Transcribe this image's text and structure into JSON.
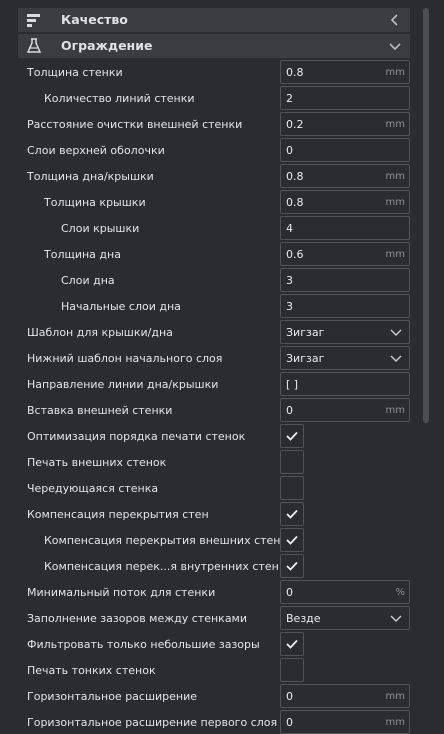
{
  "categories": [
    {
      "label": "Качество",
      "icon": "quality-icon",
      "chevron": "chevron-left-icon"
    },
    {
      "label": "Ограждение",
      "icon": "shell-icon",
      "chevron": "chevron-down-icon"
    }
  ],
  "settings": [
    {
      "label": "Толщина стенки",
      "value": "0.8",
      "unit": "mm"
    },
    {
      "label": "Количество линий стенки",
      "value": "2",
      "unit": ""
    },
    {
      "label": "Расстояние очистки внешней стенки",
      "value": "0.2",
      "unit": "mm"
    },
    {
      "label": "Слои верхней оболочки",
      "value": "0",
      "unit": ""
    },
    {
      "label": "Толщина дна/крышки",
      "value": "0.8",
      "unit": "mm"
    },
    {
      "label": "Толщина крышки",
      "value": "0.8",
      "unit": "mm"
    },
    {
      "label": "Слои крышки",
      "value": "4",
      "unit": ""
    },
    {
      "label": "Толщина дна",
      "value": "0.6",
      "unit": "mm"
    },
    {
      "label": "Слои дна",
      "value": "3",
      "unit": ""
    },
    {
      "label": "Начальные слои дна",
      "value": "3",
      "unit": ""
    },
    {
      "label": "Шаблон для крышки/дна",
      "value": "Зигзаг",
      "unit": ""
    },
    {
      "label": "Нижний шаблон начального слоя",
      "value": "Зигзаг",
      "unit": ""
    },
    {
      "label": "Направление линии дна/крышки",
      "value": "[ ]",
      "unit": ""
    },
    {
      "label": "Вставка внешней стенки",
      "value": "0",
      "unit": "mm"
    },
    {
      "label": "Оптимизация порядка печати стенок",
      "checked": true
    },
    {
      "label": "Печать внешних стенок",
      "checked": false
    },
    {
      "label": "Чередующаяся стенка",
      "checked": false
    },
    {
      "label": "Компенсация перекрытия стен",
      "checked": true
    },
    {
      "label": "Компенсация перекрытия внешних стен",
      "checked": true
    },
    {
      "label": "Компенсация перек...я внутренних стен",
      "checked": true
    },
    {
      "label": "Минимальный поток для стенки",
      "value": "0",
      "unit": "%"
    },
    {
      "label": "Заполнение зазоров между стенками",
      "value": "Везде",
      "unit": ""
    },
    {
      "label": "Фильтровать только небольшие зазоры",
      "checked": true
    },
    {
      "label": "Печать тонких стенок",
      "checked": false
    },
    {
      "label": "Горизонтальное расширение",
      "value": "0",
      "unit": "mm"
    },
    {
      "label": "Горизонтальное расширение первого слоя",
      "value": "0",
      "unit": "mm"
    }
  ]
}
